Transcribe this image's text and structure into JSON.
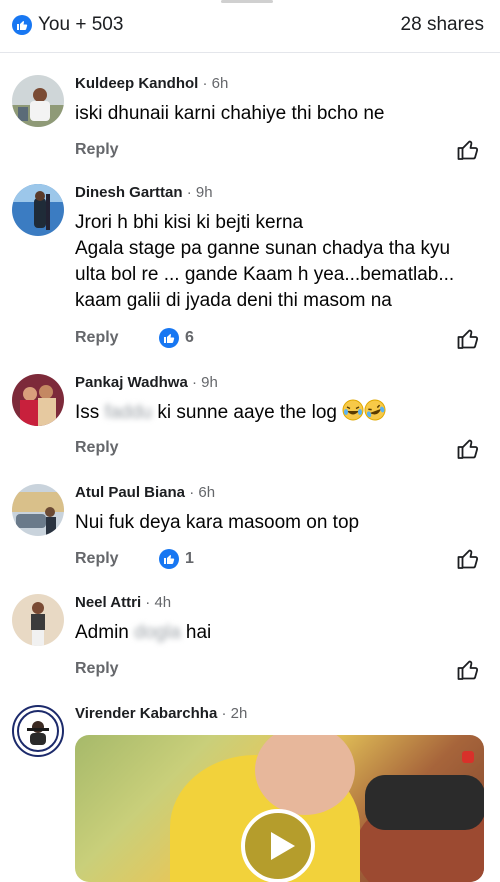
{
  "header": {
    "reactions_text": "You + 503",
    "shares_text": "28 shares"
  },
  "comments": [
    {
      "author": "Kuldeep Kandhol",
      "time": "· 6h",
      "lines": [
        "iski dhunaii karni chahiye thi bcho ne"
      ],
      "reply": "Reply",
      "likes": ""
    },
    {
      "author": "Dinesh Garttan",
      "time": "· 9h",
      "lines": [
        "Jrori h bhi kisi ki bejti kerna",
        "Agala stage pa ganne sunan chadya tha kyu",
        "ulta bol re ... gande Kaam h yea...bematlab...",
        "kaam galii di jyada deni thi masom na"
      ],
      "reply": "Reply",
      "likes": "6"
    },
    {
      "author": "Pankaj Wadhwa",
      "time": "· 9h",
      "text_start": "Iss",
      "text_blur": "faddu",
      "text_end": "ki sunne aaye the log",
      "reply": "Reply",
      "likes": ""
    },
    {
      "author": "Atul Paul Biana",
      "time": "· 6h",
      "lines": [
        "Nui fuk  deya kara masoom on top"
      ],
      "reply": "Reply",
      "likes": "1"
    },
    {
      "author": "Neel Attri",
      "time": "· 4h",
      "text_start": "Admin",
      "text_blur": "dogla",
      "text_end": "hai",
      "reply": "Reply",
      "likes": ""
    },
    {
      "author": "Virender Kabarchha",
      "time": "· 2h"
    }
  ],
  "icons": {
    "like": "like-thumb-icon",
    "emoji": "laughing-tears-emoji",
    "play": "play-icon"
  },
  "colors": {
    "accent": "#1877f2",
    "secondary_text": "#65676b"
  }
}
